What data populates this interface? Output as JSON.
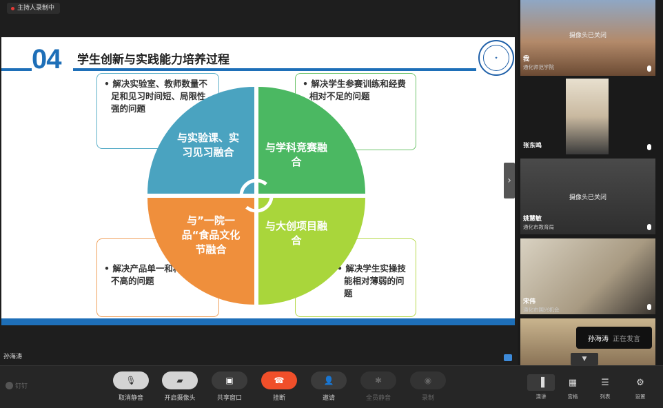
{
  "host_badge": "主持人录制中",
  "slide": {
    "number": "04",
    "title": "学生创新与实践能力培养过程",
    "boxes": [
      {
        "text": "• 解决实验室、教师数量不足和见习时间短、局限性强的问题"
      },
      {
        "text": "• 解决学生参赛训练和经费相对不足的问题"
      },
      {
        "text": "• 解决产品单一和科技含量不高的问题"
      },
      {
        "text": "• 解决学生实操技能相对薄弱的问题"
      }
    ],
    "quadrants": [
      {
        "text": "与实验课、实习见习融合",
        "color": "#4aa3c0"
      },
      {
        "text": "与学科竞赛融合",
        "color": "#4bb862"
      },
      {
        "text": "与”一院一品“食品文化节融合",
        "color": "#ef8f3c"
      },
      {
        "text": "与大创项目融合",
        "color": "#a9d63b"
      }
    ]
  },
  "speaker_name": "孙海涛",
  "sidebar": {
    "tiles": [
      {
        "name": "我",
        "org": "通化师范学院",
        "status": "摄像头已关闭"
      },
      {
        "name": "张东鸣",
        "org": "",
        "status": ""
      },
      {
        "name": "姚慧敏",
        "org": "通化市教育局",
        "status": "摄像头已关闭"
      },
      {
        "name": "宋伟",
        "org": "通化市国兴机会",
        "status": ""
      }
    ],
    "speaking": {
      "name": "孙海涛",
      "status": "正在发言"
    }
  },
  "toolbar": {
    "brand": "钉钉",
    "buttons": [
      {
        "label": "取消静音",
        "icon": "mic-off-icon"
      },
      {
        "label": "开启摄像头",
        "icon": "camera-off-icon"
      },
      {
        "label": "共享窗口",
        "icon": "screen-share-icon"
      },
      {
        "label": "挂断",
        "icon": "hangup-icon"
      },
      {
        "label": "邀请",
        "icon": "invite-icon"
      },
      {
        "label": "全员静音",
        "icon": "mute-all-icon"
      },
      {
        "label": "录制",
        "icon": "record-icon"
      }
    ],
    "right_buttons": [
      {
        "label": "演讲",
        "icon": "speaker-layout-icon"
      },
      {
        "label": "宫格",
        "icon": "grid-layout-icon"
      },
      {
        "label": "列表",
        "icon": "list-layout-icon"
      },
      {
        "label": "设置",
        "icon": "gear-icon"
      }
    ]
  }
}
